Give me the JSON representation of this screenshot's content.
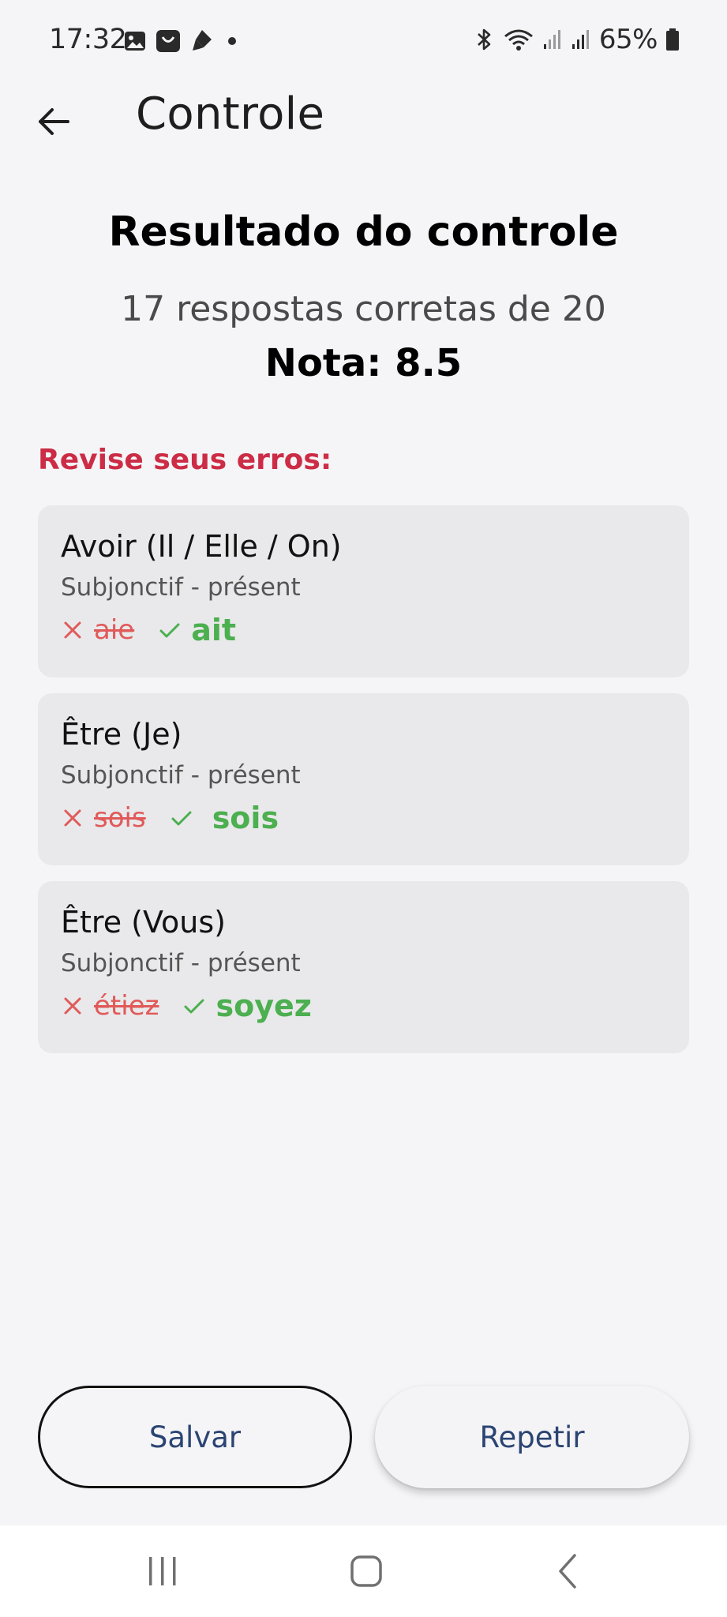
{
  "status_bar": {
    "time": "17:32",
    "battery": "65%",
    "left_icons": [
      "image-icon",
      "shop-icon",
      "pen-icon",
      "dot-icon"
    ],
    "right_icons": [
      "bluetooth-icon",
      "wifi-icon",
      "signal-icon",
      "signal-icon",
      "battery-icon"
    ]
  },
  "app_bar": {
    "title": "Controle",
    "back_icon": "arrow-left-icon"
  },
  "result": {
    "title": "Resultado do controle",
    "summary": "17 respostas corretas de 20",
    "grade": "Nota: 8.5"
  },
  "review": {
    "heading": "Revise seus erros:",
    "items": [
      {
        "verb": "Avoir (Il / Elle / On)",
        "tense": "Subjonctif - présent",
        "wrong": "aie",
        "correct": "ait"
      },
      {
        "verb": "Être (Je)",
        "tense": "Subjonctif - présent",
        "wrong": "sois",
        "correct": "sois"
      },
      {
        "verb": "Être (Vous)",
        "tense": "Subjonctif - présent",
        "wrong": "étiez",
        "correct": "soyez"
      }
    ]
  },
  "actions": {
    "save_label": "Salvar",
    "repeat_label": "Repetir"
  },
  "colors": {
    "background": "#f5f5f7",
    "card": "#e9e9eb",
    "error_heading": "#cc2c45",
    "wrong": "#e15a5a",
    "correct": "#4caf50",
    "button_text": "#2b4472"
  }
}
